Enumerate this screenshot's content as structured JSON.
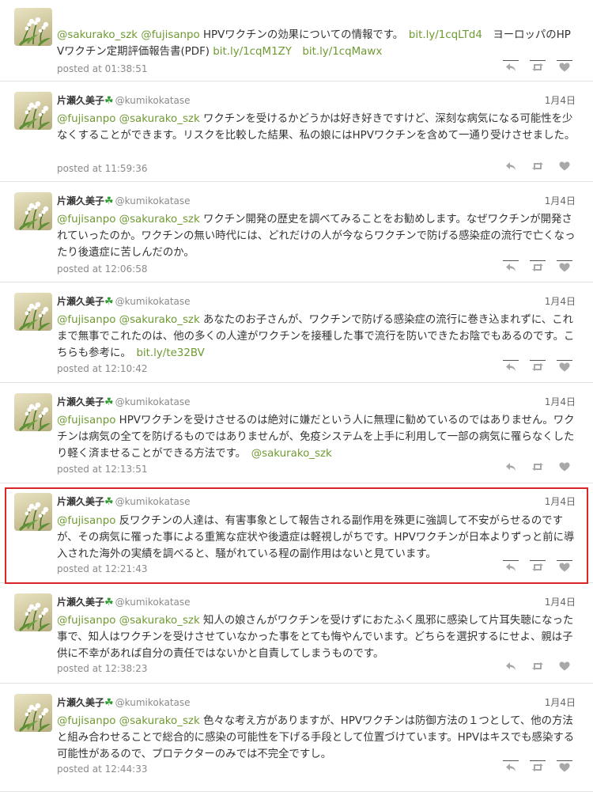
{
  "tweets": [
    {
      "name": "",
      "handle": "",
      "date": "",
      "segments": [
        {
          "t": "mention",
          "v": "@sakurako_szk"
        },
        {
          "t": "text",
          "v": " "
        },
        {
          "t": "mention",
          "v": "@fujisanpo"
        },
        {
          "t": "text",
          "v": " HPVワクチンの効果についての情報です。　"
        },
        {
          "t": "link",
          "v": "bit.ly/1cqLTd4"
        },
        {
          "t": "text",
          "v": "　ヨーロッパのHPVワクチン定期評価報告書(PDF) "
        },
        {
          "t": "link",
          "v": "bit.ly/1cqM1ZY"
        },
        {
          "t": "text",
          "v": "　"
        },
        {
          "t": "link",
          "v": "bit.ly/1cqMawx"
        }
      ],
      "posted": "posted at 01:38:51"
    },
    {
      "name": "片瀬久美子",
      "handle": "@kumikokatase",
      "date": "1月4日",
      "segments": [
        {
          "t": "mention",
          "v": "@fujisanpo"
        },
        {
          "t": "text",
          "v": " "
        },
        {
          "t": "mention",
          "v": "@sakurako_szk"
        },
        {
          "t": "text",
          "v": " ワクチンを受けるかどうかは好き好きですけど、深刻な病気になる可能性を少なくすることができます。リスクを比較した結果、私の娘にはHPVワクチンを含めて一通り受けさせました。"
        }
      ],
      "posted": "posted at 11:59:36"
    },
    {
      "name": "片瀬久美子",
      "handle": "@kumikokatase",
      "date": "1月4日",
      "segments": [
        {
          "t": "mention",
          "v": "@fujisanpo"
        },
        {
          "t": "text",
          "v": " "
        },
        {
          "t": "mention",
          "v": "@sakurako_szk"
        },
        {
          "t": "text",
          "v": " ワクチン開発の歴史を調べてみることをお勧めします。なぜワクチンが開発されていったのか。ワクチンの無い時代には、どれだけの人が今ならワクチンで防げる感染症の流行で亡くなったり後遺症に苦しんだのか。"
        }
      ],
      "posted": "posted at 12:06:58"
    },
    {
      "name": "片瀬久美子",
      "handle": "@kumikokatase",
      "date": "1月4日",
      "segments": [
        {
          "t": "mention",
          "v": "@fujisanpo"
        },
        {
          "t": "text",
          "v": " "
        },
        {
          "t": "mention",
          "v": "@sakurako_szk"
        },
        {
          "t": "text",
          "v": " あなたのお子さんが、ワクチンで防げる感染症の流行に巻き込まれずに、これまで無事でこれたのは、他の多くの人達がワクチンを接種した事で流行を防いできたお陰でもあるのです。こちらも参考に。　"
        },
        {
          "t": "link",
          "v": "bit.ly/te32BV"
        }
      ],
      "posted": "posted at 12:10:42"
    },
    {
      "name": "片瀬久美子",
      "handle": "@kumikokatase",
      "date": "1月4日",
      "segments": [
        {
          "t": "mention",
          "v": "@fujisanpo"
        },
        {
          "t": "text",
          "v": " HPVワクチンを受けさせるのは絶対に嫌だという人に無理に勧めているのではありません。ワクチンは病気の全てを防げるものではありませんが、免疫システムを上手に利用して一部の病気に罹らなくしたり軽く済ませることができる方法です。　"
        },
        {
          "t": "mention",
          "v": "@sakurako_szk"
        }
      ],
      "posted": "posted at 12:13:51"
    },
    {
      "name": "片瀬久美子",
      "handle": "@kumikokatase",
      "date": "1月4日",
      "segments": [
        {
          "t": "mention",
          "v": "@fujisanpo"
        },
        {
          "t": "text",
          "v": " 反ワクチンの人達は、有害事象として報告される副作用を殊更に強調して不安がらせるのですが、その病気に罹った事による重篤な症状や後遺症は軽視しがちです。HPVワクチンが日本よりずっと前に導入された海外の実績を調べると、騒がれている程の副作用はないと見ています。"
        }
      ],
      "posted": "posted at 12:21:43"
    },
    {
      "name": "片瀬久美子",
      "handle": "@kumikokatase",
      "date": "1月4日",
      "segments": [
        {
          "t": "mention",
          "v": "@fujisanpo"
        },
        {
          "t": "text",
          "v": " "
        },
        {
          "t": "mention",
          "v": "@sakurako_szk"
        },
        {
          "t": "text",
          "v": " 知人の娘さんがワクチンを受けずにおたふく風邪に感染して片耳失聴になった事で、知人はワクチンを受けさせていなかった事をとても悔やんでいます。どちらを選択するにせよ、親は子供に不幸があれば自分の責任ではないかと自責してしまうものです。"
        }
      ],
      "posted": "posted at 12:38:23"
    },
    {
      "name": "片瀬久美子",
      "handle": "@kumikokatase",
      "date": "1月4日",
      "segments": [
        {
          "t": "mention",
          "v": "@fujisanpo"
        },
        {
          "t": "text",
          "v": " "
        },
        {
          "t": "mention",
          "v": "@sakurako_szk"
        },
        {
          "t": "text",
          "v": " 色々な考え方がありますが、HPVワクチンは防御方法の１つとして、他の方法と組み合わせることで総合的に感染の可能性を下げる手段として位置づけています。HPVはキスでも感染する可能性があるので、プロテクターのみでは不完全ですし。"
        }
      ],
      "posted": "posted at 12:44:33"
    }
  ],
  "icons": {
    "reply": "reply-icon",
    "retweet": "retweet-icon",
    "favorite": "heart-icon",
    "clover": "clover-icon"
  },
  "colors": {
    "mention": "#6f9a32",
    "highlight_border": "#d9262b"
  }
}
